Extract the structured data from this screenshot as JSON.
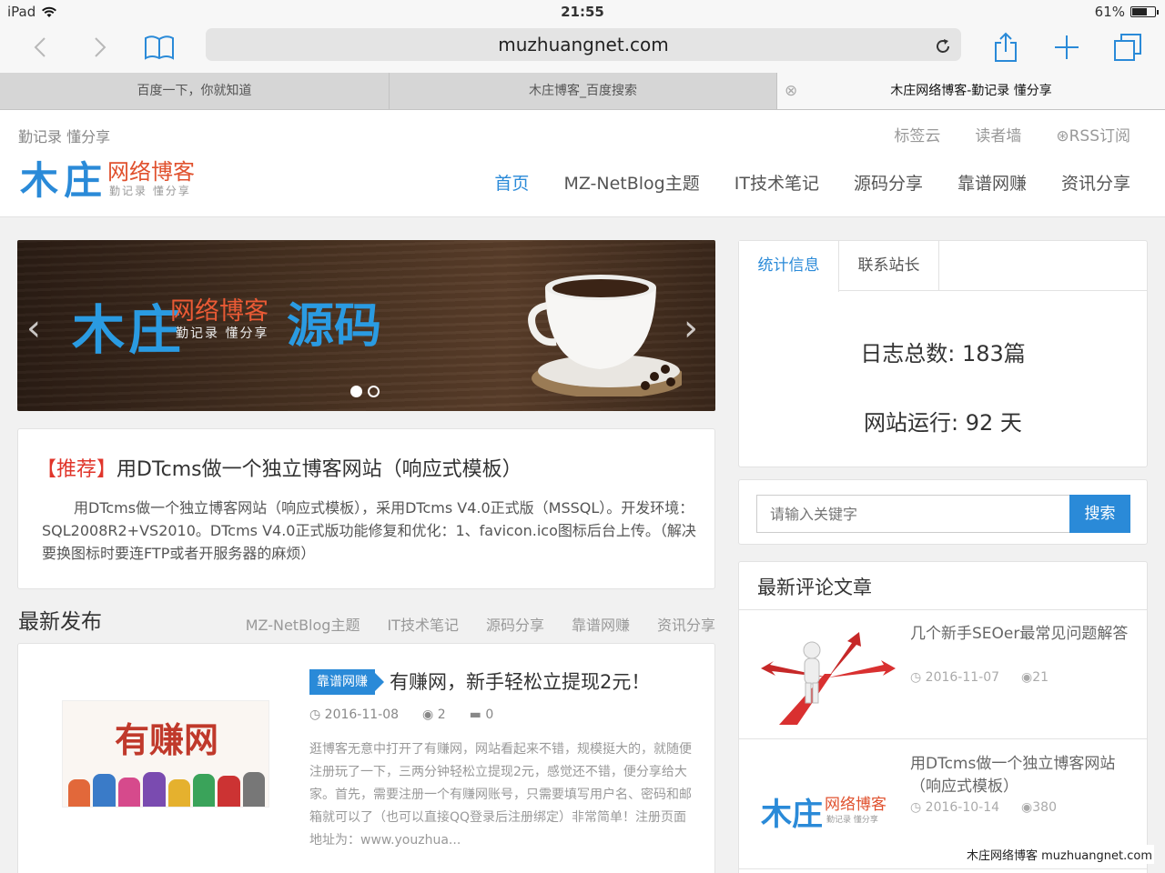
{
  "status": {
    "device": "iPad",
    "time": "21:55",
    "battery": "61%",
    "battery_level": 0.61
  },
  "browser": {
    "url": "muzhuangnet.com",
    "tabs": [
      {
        "label": "百度一下，你就知道"
      },
      {
        "label": "木庄博客_百度搜索"
      },
      {
        "label": "木庄网络博客-勤记录 懂分享"
      }
    ]
  },
  "header": {
    "slogan": "勤记录 懂分享",
    "toplinks": [
      "标签云",
      "读者墙",
      "RSS订阅"
    ],
    "logo": {
      "main": "木庄",
      "red": "网络博客",
      "sub": "勤记录 懂分享"
    },
    "nav": [
      "首页",
      "MZ-NetBlog主题",
      "IT技术笔记",
      "源码分享",
      "靠谱网赚",
      "资讯分享"
    ]
  },
  "banner": {
    "main": "木庄",
    "red": "网络博客",
    "sub": "勤记录 懂分享",
    "word": "源码"
  },
  "recommend": {
    "tag": "【推荐】",
    "title": "用DTcms做一个独立博客网站（响应式模板）",
    "desc": "用DTcms做一个独立博客网站（响应式模板），采用DTcms V4.0正式版（MSSQL）。开发环境：SQL2008R2+VS2010。DTcms V4.0正式版功能修复和优化：1、favicon.ico图标后台上传。（解决要换图标时要连FTP或者开服务器的麻烦）"
  },
  "latest": {
    "title": "最新发布",
    "categories": [
      "MZ-NetBlog主题",
      "IT技术笔记",
      "源码分享",
      "靠谱网赚",
      "资讯分享"
    ],
    "post": {
      "badge": "靠谱网赚",
      "title": "有赚网，新手轻松立提现2元！",
      "thumb_text": "有赚网",
      "date": "2016-11-08",
      "views": "2",
      "comments": "0",
      "excerpt": "逛博客无意中打开了有赚网，网站看起来不错，规模挺大的，就随便注册玩了一下，三两分钟轻松立提现2元，感觉还不错，便分享给大家。首先，需要注册一个有赚网账号，只需要填写用户名、密码和邮箱就可以了（也可以直接QQ登录后注册绑定）非常简单！注册页面地址为：www.youzhua..."
    }
  },
  "stats": {
    "tabs": [
      "统计信息",
      "联系站长"
    ],
    "line1": "日志总数: 183篇",
    "line2": "网站运行: 92 天"
  },
  "search": {
    "placeholder": "请输入关键字",
    "button": "搜索"
  },
  "comments": {
    "title": "最新评论文章",
    "items": [
      {
        "title": "几个新手SEOer最常见问题解答",
        "date": "2016-11-07",
        "views": "21"
      },
      {
        "title": "用DTcms做一个独立博客网站（响应式模板）",
        "date": "2016-10-14",
        "views": "380",
        "logo_main": "木庄",
        "logo_red": "网络博客",
        "logo_sub": "勤记录 懂分享"
      }
    ]
  },
  "watermark": "木庄网络博客 muzhuangnet.com",
  "colors": {
    "accent": "#2a8ad8",
    "logo_red": "#e0512e",
    "tag_red": "#e0352b"
  },
  "icons": [
    "wifi-icon",
    "back-icon",
    "forward-icon",
    "bookmarks-icon",
    "reload-icon",
    "share-icon",
    "new-tab-icon",
    "tabs-overview-icon",
    "close-tab-icon",
    "rss-icon",
    "clock-icon",
    "eye-icon",
    "comment-icon"
  ]
}
